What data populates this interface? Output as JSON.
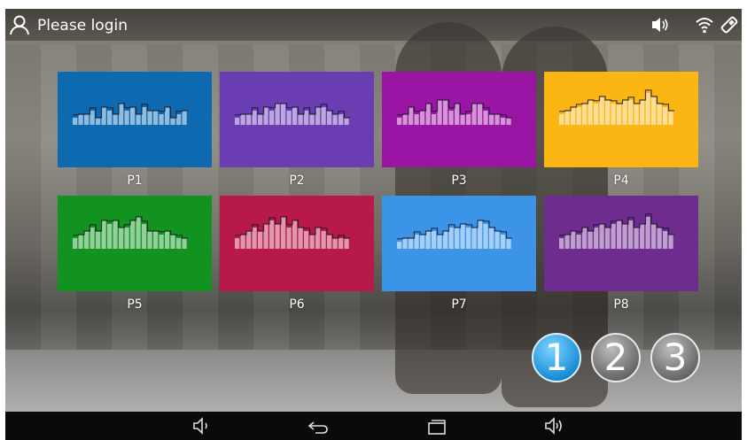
{
  "topbar": {
    "login_text": "Please login",
    "icons": [
      "user-icon",
      "volume-icon",
      "wifi-icon",
      "bluetooth-icon"
    ]
  },
  "programs": [
    {
      "label": "P1",
      "color": "#0e6ab0"
    },
    {
      "label": "P2",
      "color": "#6a3db3"
    },
    {
      "label": "P3",
      "color": "#9b15a5"
    },
    {
      "label": "P4",
      "color": "#fbb613"
    },
    {
      "label": "P5",
      "color": "#12931f"
    },
    {
      "label": "P6",
      "color": "#b71a48"
    },
    {
      "label": "P7",
      "color": "#3b94e8"
    },
    {
      "label": "P8",
      "color": "#6f2c8f"
    }
  ],
  "pagination": {
    "pages": [
      "1",
      "2",
      "3"
    ],
    "active": "1"
  },
  "navbar": {
    "icons": [
      "volume-down-icon",
      "back-icon",
      "recent-apps-icon",
      "volume-up-icon"
    ]
  }
}
